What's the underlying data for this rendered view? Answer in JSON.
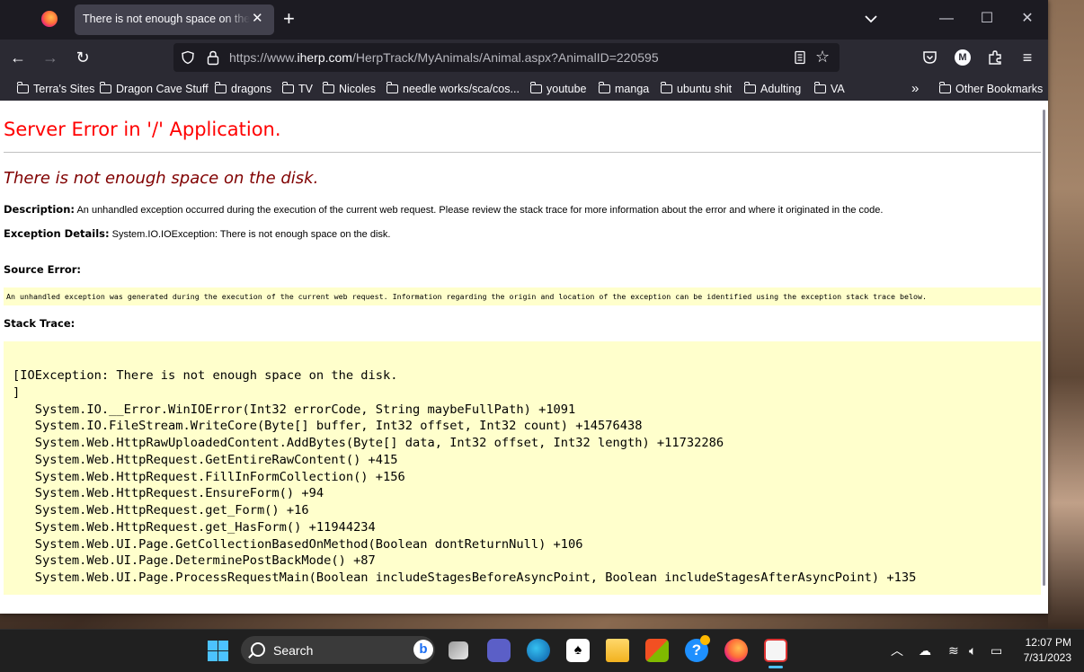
{
  "browser": {
    "tab_title": "There is not enough space on the disk",
    "url_prefix": "https://www.",
    "url_domain": "iherp.com",
    "url_path": "/HerpTrack/MyAnimals/Animal.aspx?AnimalID=220595",
    "profile_initial": "M"
  },
  "bookmarks": {
    "items": [
      "Terra's Sites",
      "Dragon Cave Stuff",
      "dragons",
      "TV",
      "Nicoles",
      "needle works/sca/cos...",
      "youtube",
      "manga",
      "ubuntu shit",
      "Adulting",
      "VA"
    ],
    "other": "Other Bookmarks"
  },
  "page": {
    "title": "Server Error in '/' Application.",
    "message": "There is not enough space on the disk.",
    "description_label": "Description:",
    "description_text": "An unhandled exception occurred during the execution of the current web request. Please review the stack trace for more information about the error and where it originated in the code.",
    "exception_label": "Exception Details:",
    "exception_text": "System.IO.IOException: There is not enough space on the disk.",
    "source_error_label": "Source Error:",
    "source_error_text": "An unhandled exception was generated during the execution of the current web request. Information regarding the origin and location of the exception can be identified using the exception stack trace below.",
    "stack_trace_label": "Stack Trace:",
    "stack_lines": [
      "[IOException: There is not enough space on the disk.",
      "]",
      "   System.IO.__Error.WinIOError(Int32 errorCode, String maybeFullPath) +1091",
      "   System.IO.FileStream.WriteCore(Byte[] buffer, Int32 offset, Int32 count) +14576438",
      "   System.Web.HttpRawUploadedContent.AddBytes(Byte[] data, Int32 offset, Int32 length) +11732286",
      "   System.Web.HttpRequest.GetEntireRawContent() +415",
      "   System.Web.HttpRequest.FillInFormCollection() +156",
      "   System.Web.HttpRequest.EnsureForm() +94",
      "   System.Web.HttpRequest.get_Form() +16",
      "   System.Web.HttpRequest.get_HasForm() +11944234",
      "   System.Web.UI.Page.GetCollectionBasedOnMethod(Boolean dontReturnNull) +106",
      "   System.Web.UI.Page.DeterminePostBackMode() +87",
      "   System.Web.UI.Page.ProcessRequestMain(Boolean includeStagesBeforeAsyncPoint, Boolean includeStagesAfterAsyncPoint) +135"
    ]
  },
  "taskbar": {
    "search_label": "Search",
    "time": "12:07 PM",
    "date": "7/31/2023"
  },
  "colors": {
    "error_title": "#ff0000",
    "error_message": "#800000",
    "code_background": "#ffffcc",
    "accent": "#4cc2ff"
  }
}
